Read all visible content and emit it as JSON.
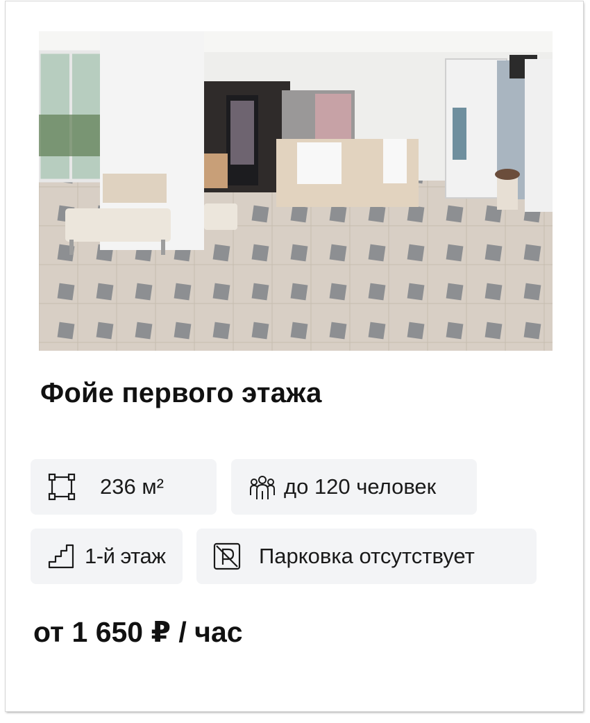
{
  "venue": {
    "title": "Фойе первого этажа",
    "photo_alt": "",
    "features": {
      "area": {
        "icon": "area-square-icon",
        "text": "236 м²"
      },
      "capacity": {
        "icon": "people-group-icon",
        "text": "до 120 человек"
      },
      "floor": {
        "icon": "stairs-icon",
        "text": "1-й этаж"
      },
      "parking": {
        "icon": "no-parking-icon",
        "text": "Парковка отсутствует"
      }
    },
    "price": "от 1 650 ₽ / час"
  },
  "colors": {
    "chip_background": "#f3f4f6",
    "text": "#111111"
  }
}
